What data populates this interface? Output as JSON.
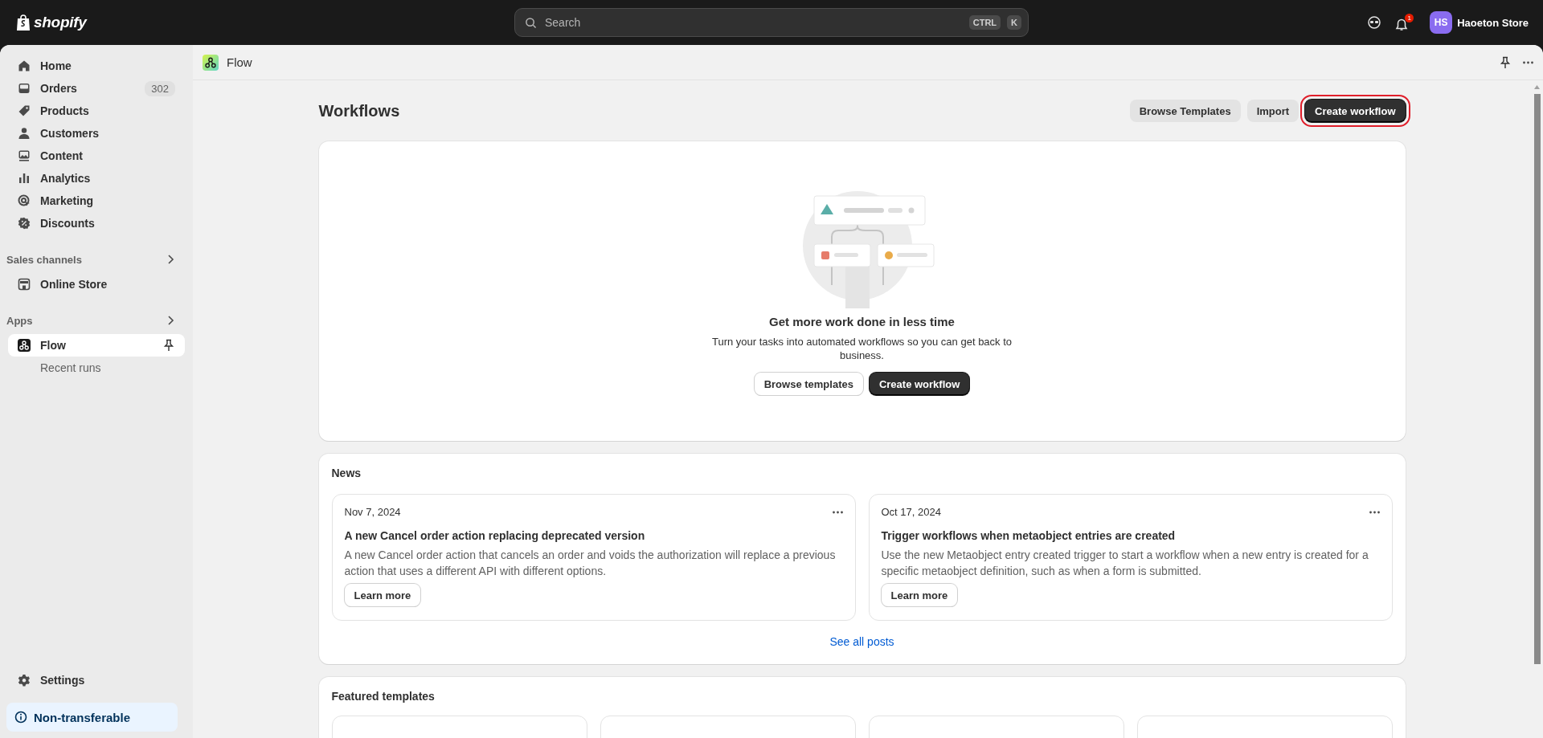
{
  "top_bar": {
    "logo_text": "shopify",
    "search": {
      "placeholder": "Search",
      "keys": [
        "CTRL",
        "K"
      ]
    },
    "notification_count": "1",
    "store": {
      "initials": "HS",
      "name": "Haoeton Store"
    }
  },
  "sidebar": {
    "items": [
      {
        "label": "Home",
        "selected": false
      },
      {
        "label": "Orders",
        "badge": "302",
        "selected": false
      },
      {
        "label": "Products",
        "selected": false
      },
      {
        "label": "Customers",
        "selected": false
      },
      {
        "label": "Content",
        "selected": false
      },
      {
        "label": "Analytics",
        "selected": false
      },
      {
        "label": "Marketing",
        "selected": false
      },
      {
        "label": "Discounts",
        "selected": false
      }
    ],
    "sections": [
      {
        "title": "Sales channels",
        "items": [
          {
            "label": "Online Store",
            "kind": "store",
            "selected": false,
            "pinned": false
          }
        ]
      },
      {
        "title": "Apps",
        "items": [
          {
            "label": "Flow",
            "kind": "app",
            "selected": true,
            "pinned": true,
            "children": [
              {
                "label": "Recent runs",
                "selected": false
              }
            ]
          }
        ]
      }
    ],
    "settings": {
      "label": "Settings"
    },
    "notice": {
      "label": "Non-transferable"
    }
  },
  "app_header": {
    "title": "Flow"
  },
  "page": {
    "title": "Workflows",
    "actions": [
      {
        "label": "Browse Templates",
        "kind": "secondary",
        "highlighted": false
      },
      {
        "label": "Import",
        "kind": "secondary",
        "highlighted": false
      },
      {
        "label": "Create workflow",
        "kind": "primary",
        "highlighted": true
      }
    ]
  },
  "empty_state": {
    "heading": "Get more work done in less time",
    "text": "Turn your tasks into automated workflows so you can get back to business.",
    "actions": [
      {
        "label": "Browse templates",
        "kind": "secondary"
      },
      {
        "label": "Create workflow",
        "kind": "primary"
      }
    ]
  },
  "news": {
    "title": "News",
    "posts": [
      {
        "date": "Nov 7, 2024",
        "title": "A new Cancel order action replacing deprecated version",
        "body": "A new Cancel order action that cancels an order and voids the authorization will replace a previous action that uses a different API with different options.",
        "action": "Learn more"
      },
      {
        "date": "Oct 17, 2024",
        "title": "Trigger workflows when metaobject entries are created",
        "body": "Use the new Metaobject entry created trigger to start a workflow when a new entry is created for a specific metaobject definition, such as when a form is submitted.",
        "action": "Learn more"
      }
    ],
    "link": "See all posts"
  },
  "featured_templates": {
    "title": "Featured templates"
  }
}
